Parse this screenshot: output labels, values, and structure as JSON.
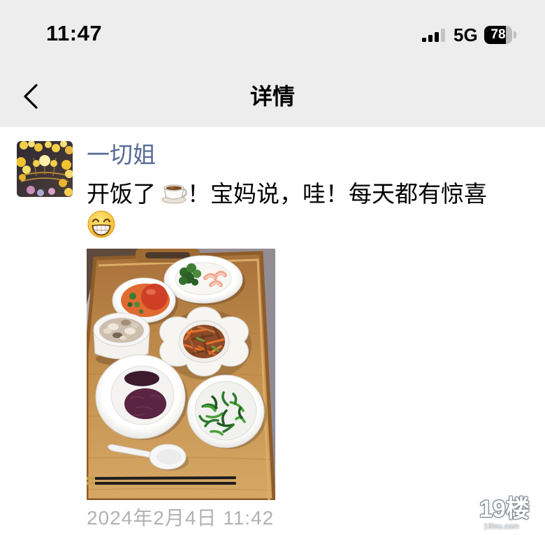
{
  "status_bar": {
    "time": "11:47",
    "network": "5G",
    "battery": "78",
    "signal_bars_total": 4,
    "signal_bars_active": 3,
    "signal_icon": "signal-icon",
    "battery_icon": "battery-icon"
  },
  "nav": {
    "back_icon": "chevron-left-icon",
    "title": "详情"
  },
  "post": {
    "author": "一切姐",
    "avatar": "avatar-image",
    "content": {
      "text_1": "开饭了",
      "emoji_1": "coffee-emoji-icon",
      "text_2": "！宝妈说，哇！每天都有惊喜",
      "emoji_2": "grin-emoji-icon"
    },
    "photo": "food-tray-photo",
    "timestamp": "2024年2月4日 11:42"
  },
  "watermark": {
    "logo": "19楼",
    "domain": "19lou.com"
  },
  "colors": {
    "header_bg": "#ededed",
    "author_name": "#576b95",
    "timestamp": "#b2b2b2",
    "text": "#000000"
  }
}
